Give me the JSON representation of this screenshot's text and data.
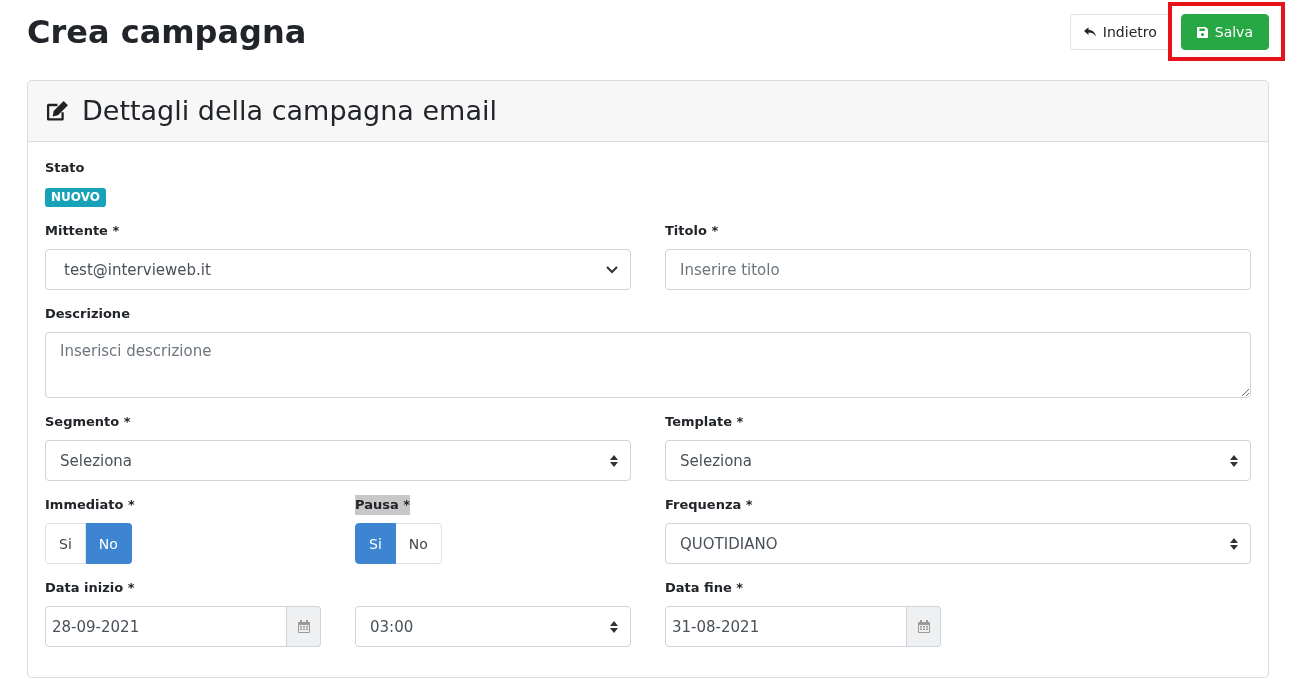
{
  "page": {
    "title": "Crea campagna"
  },
  "actions": [
    {
      "kind": "back",
      "label": "Indietro",
      "highlighted": false
    },
    {
      "kind": "save",
      "label": "Salva",
      "highlighted": true
    }
  ],
  "card": {
    "title": "Dettagli della campagna email",
    "rows": [
      {
        "fields": [
          {
            "kind": "badge",
            "label": "Stato",
            "value": "NUOVO",
            "highlighted": false
          }
        ]
      },
      {
        "fields": [
          {
            "kind": "dropdown",
            "label": "Mittente *",
            "value": "test@intervieweb.it",
            "highlighted": false
          },
          {
            "kind": "text",
            "label": "Titolo *",
            "placeholder": "Inserire titolo",
            "highlighted": false
          }
        ]
      },
      {
        "fields": [
          {
            "kind": "textarea",
            "label": "Descrizione",
            "placeholder": "Inserisci descrizione",
            "highlighted": false
          }
        ]
      },
      {
        "fields": [
          {
            "kind": "select",
            "label": "Segmento *",
            "value": "Seleziona",
            "highlighted": false
          },
          {
            "kind": "select",
            "label": "Template *",
            "value": "Seleziona",
            "highlighted": false
          }
        ]
      },
      {
        "fields": [
          {
            "kind": "toggle",
            "label": "Immediato *",
            "highlighted": false,
            "options": [
              {
                "label": "Si",
                "selected": false
              },
              {
                "label": "No",
                "selected": true
              }
            ]
          },
          {
            "kind": "toggle",
            "label": "Pausa *",
            "highlighted": true,
            "options": [
              {
                "label": "Si",
                "selected": true
              },
              {
                "label": "No",
                "selected": false
              }
            ]
          },
          {
            "kind": "select",
            "label": "Frequenza *",
            "value": "QUOTIDIANO",
            "highlighted": false
          }
        ]
      },
      {
        "fields": [
          {
            "kind": "date",
            "label": "Data inizio *",
            "value": "28-09-2021",
            "highlighted": false
          },
          {
            "kind": "time",
            "value": "03:00"
          },
          {
            "kind": "date",
            "label": "Data fine *",
            "value": "31-08-2021",
            "highlighted": false
          }
        ]
      }
    ]
  }
}
